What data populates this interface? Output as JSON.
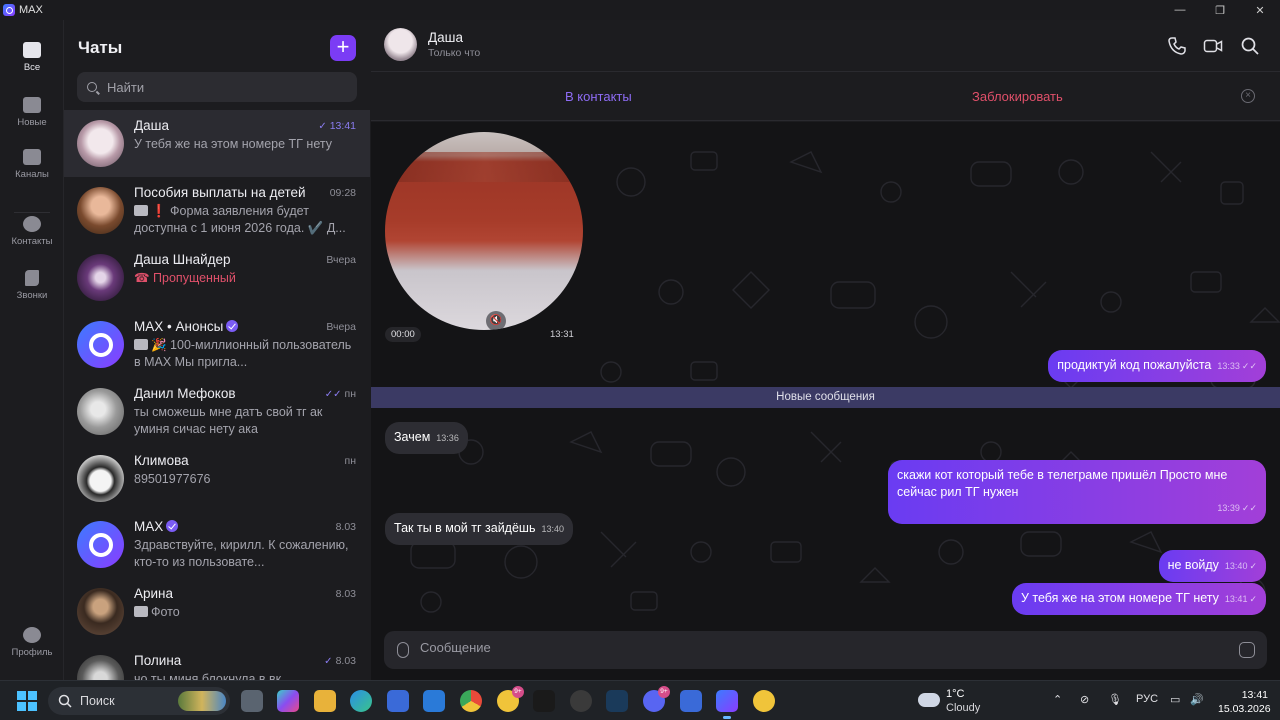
{
  "window": {
    "title": "MAX",
    "controls": [
      "—",
      "❐",
      "✕"
    ]
  },
  "rail": {
    "items": [
      {
        "label": "Все",
        "icon": "chat-bubble-icon"
      },
      {
        "label": "Новые",
        "icon": "folder-icon"
      },
      {
        "label": "Каналы",
        "icon": "folder-icon"
      },
      {
        "label": "Контакты",
        "icon": "contacts-icon"
      },
      {
        "label": "Звонки",
        "icon": "phone-icon"
      }
    ],
    "profile_label": "Профиль"
  },
  "chatlist": {
    "title": "Чаты",
    "new_chat": "+",
    "search_placeholder": "Найти",
    "chats": [
      {
        "name": "Даша",
        "time": "13:41",
        "message": "У тебя же на этом номере ТГ нету"
      },
      {
        "name": "Пособия выплаты на детей",
        "time": "09:28",
        "message": "❗ Форма заявления будет доступна с 1 июня 2026 года. ✔️ Д..."
      },
      {
        "name": "Даша Шнайдер",
        "time": "Вчера",
        "message": "Пропущенный"
      },
      {
        "name": "MAX • Анонсы",
        "time": "Вчера",
        "message": "🎉 100-миллионный пользователь в MAX  Мы пригла..."
      },
      {
        "name": "Данил Мефоков",
        "time": "пн",
        "message": "ты сможешь мне датъ свой тг ак уминя сичас нету ака"
      },
      {
        "name": "Климова",
        "time": "пн",
        "message": "89501977676"
      },
      {
        "name": "MAX",
        "time": "8.03",
        "message": "Здравствуйте, кирилл.  К сожалению, кто-то из пользовате..."
      },
      {
        "name": "Арина",
        "time": "8.03",
        "message": "Фото"
      },
      {
        "name": "Полина",
        "time": "8.03",
        "message": "чо ты миня блокнула в вк"
      }
    ]
  },
  "header": {
    "name": "Даша",
    "status": "Только что",
    "add_contact": "В контакты",
    "block": "Заблокировать",
    "close": "×"
  },
  "video_message": {
    "duration": "00:00",
    "time": "13:31"
  },
  "new_messages_label": "Новые сообщения",
  "messages": [
    {
      "dir": "out",
      "text": "продиктуй код пожалуйста",
      "time": "13:33",
      "status": "✓✓"
    },
    {
      "dir": "in",
      "text": "Зачем",
      "time": "13:36"
    },
    {
      "dir": "out",
      "text": "скажи кот который тебе в телеграме пришёл Просто мне сейчас рил ТГ нужен",
      "time": "13:39",
      "status": "✓✓"
    },
    {
      "dir": "in",
      "text": "Так ты в мой тг зайдёшь",
      "time": "13:40"
    },
    {
      "dir": "out",
      "text": "не войду",
      "time": "13:40",
      "status": "✓"
    },
    {
      "dir": "out",
      "text": "У тебя же на этом номере ТГ нету",
      "time": "13:41",
      "status": "✓"
    }
  ],
  "composer": {
    "placeholder": "Сообщение"
  },
  "taskbar": {
    "search_label": "Поиск",
    "badge_count": "9+",
    "weather_temp": "1°C",
    "weather_cond": "Cloudy",
    "lang": "РУС",
    "time": "13:41",
    "date": "15.03.2026"
  },
  "colors": {
    "accent": "#7b3cf5",
    "block": "#e0506a",
    "new_messages_bar": "#3b3a64"
  }
}
